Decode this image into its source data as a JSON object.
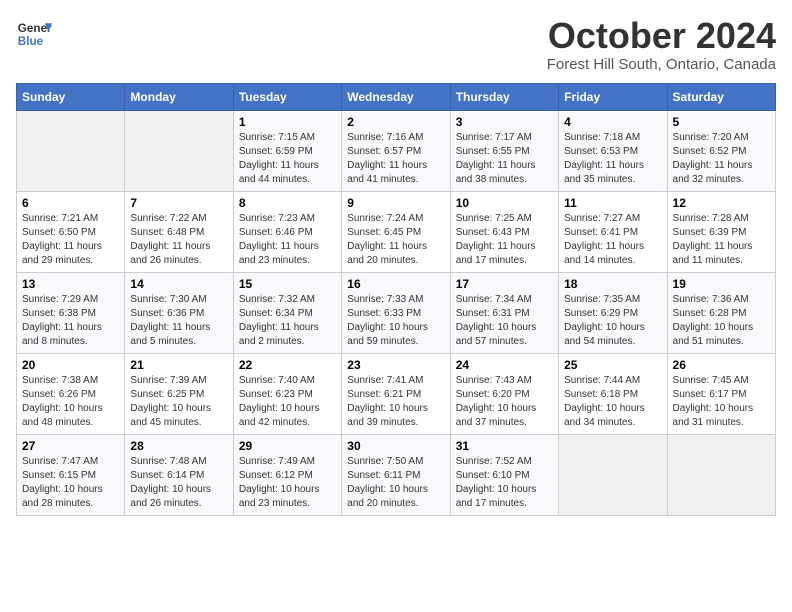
{
  "header": {
    "logo_line1": "General",
    "logo_line2": "Blue",
    "month": "October 2024",
    "location": "Forest Hill South, Ontario, Canada"
  },
  "weekdays": [
    "Sunday",
    "Monday",
    "Tuesday",
    "Wednesday",
    "Thursday",
    "Friday",
    "Saturday"
  ],
  "weeks": [
    [
      {
        "day": "",
        "info": ""
      },
      {
        "day": "",
        "info": ""
      },
      {
        "day": "1",
        "info": "Sunrise: 7:15 AM\nSunset: 6:59 PM\nDaylight: 11 hours and 44 minutes."
      },
      {
        "day": "2",
        "info": "Sunrise: 7:16 AM\nSunset: 6:57 PM\nDaylight: 11 hours and 41 minutes."
      },
      {
        "day": "3",
        "info": "Sunrise: 7:17 AM\nSunset: 6:55 PM\nDaylight: 11 hours and 38 minutes."
      },
      {
        "day": "4",
        "info": "Sunrise: 7:18 AM\nSunset: 6:53 PM\nDaylight: 11 hours and 35 minutes."
      },
      {
        "day": "5",
        "info": "Sunrise: 7:20 AM\nSunset: 6:52 PM\nDaylight: 11 hours and 32 minutes."
      }
    ],
    [
      {
        "day": "6",
        "info": "Sunrise: 7:21 AM\nSunset: 6:50 PM\nDaylight: 11 hours and 29 minutes."
      },
      {
        "day": "7",
        "info": "Sunrise: 7:22 AM\nSunset: 6:48 PM\nDaylight: 11 hours and 26 minutes."
      },
      {
        "day": "8",
        "info": "Sunrise: 7:23 AM\nSunset: 6:46 PM\nDaylight: 11 hours and 23 minutes."
      },
      {
        "day": "9",
        "info": "Sunrise: 7:24 AM\nSunset: 6:45 PM\nDaylight: 11 hours and 20 minutes."
      },
      {
        "day": "10",
        "info": "Sunrise: 7:25 AM\nSunset: 6:43 PM\nDaylight: 11 hours and 17 minutes."
      },
      {
        "day": "11",
        "info": "Sunrise: 7:27 AM\nSunset: 6:41 PM\nDaylight: 11 hours and 14 minutes."
      },
      {
        "day": "12",
        "info": "Sunrise: 7:28 AM\nSunset: 6:39 PM\nDaylight: 11 hours and 11 minutes."
      }
    ],
    [
      {
        "day": "13",
        "info": "Sunrise: 7:29 AM\nSunset: 6:38 PM\nDaylight: 11 hours and 8 minutes."
      },
      {
        "day": "14",
        "info": "Sunrise: 7:30 AM\nSunset: 6:36 PM\nDaylight: 11 hours and 5 minutes."
      },
      {
        "day": "15",
        "info": "Sunrise: 7:32 AM\nSunset: 6:34 PM\nDaylight: 11 hours and 2 minutes."
      },
      {
        "day": "16",
        "info": "Sunrise: 7:33 AM\nSunset: 6:33 PM\nDaylight: 10 hours and 59 minutes."
      },
      {
        "day": "17",
        "info": "Sunrise: 7:34 AM\nSunset: 6:31 PM\nDaylight: 10 hours and 57 minutes."
      },
      {
        "day": "18",
        "info": "Sunrise: 7:35 AM\nSunset: 6:29 PM\nDaylight: 10 hours and 54 minutes."
      },
      {
        "day": "19",
        "info": "Sunrise: 7:36 AM\nSunset: 6:28 PM\nDaylight: 10 hours and 51 minutes."
      }
    ],
    [
      {
        "day": "20",
        "info": "Sunrise: 7:38 AM\nSunset: 6:26 PM\nDaylight: 10 hours and 48 minutes."
      },
      {
        "day": "21",
        "info": "Sunrise: 7:39 AM\nSunset: 6:25 PM\nDaylight: 10 hours and 45 minutes."
      },
      {
        "day": "22",
        "info": "Sunrise: 7:40 AM\nSunset: 6:23 PM\nDaylight: 10 hours and 42 minutes."
      },
      {
        "day": "23",
        "info": "Sunrise: 7:41 AM\nSunset: 6:21 PM\nDaylight: 10 hours and 39 minutes."
      },
      {
        "day": "24",
        "info": "Sunrise: 7:43 AM\nSunset: 6:20 PM\nDaylight: 10 hours and 37 minutes."
      },
      {
        "day": "25",
        "info": "Sunrise: 7:44 AM\nSunset: 6:18 PM\nDaylight: 10 hours and 34 minutes."
      },
      {
        "day": "26",
        "info": "Sunrise: 7:45 AM\nSunset: 6:17 PM\nDaylight: 10 hours and 31 minutes."
      }
    ],
    [
      {
        "day": "27",
        "info": "Sunrise: 7:47 AM\nSunset: 6:15 PM\nDaylight: 10 hours and 28 minutes."
      },
      {
        "day": "28",
        "info": "Sunrise: 7:48 AM\nSunset: 6:14 PM\nDaylight: 10 hours and 26 minutes."
      },
      {
        "day": "29",
        "info": "Sunrise: 7:49 AM\nSunset: 6:12 PM\nDaylight: 10 hours and 23 minutes."
      },
      {
        "day": "30",
        "info": "Sunrise: 7:50 AM\nSunset: 6:11 PM\nDaylight: 10 hours and 20 minutes."
      },
      {
        "day": "31",
        "info": "Sunrise: 7:52 AM\nSunset: 6:10 PM\nDaylight: 10 hours and 17 minutes."
      },
      {
        "day": "",
        "info": ""
      },
      {
        "day": "",
        "info": ""
      }
    ]
  ]
}
